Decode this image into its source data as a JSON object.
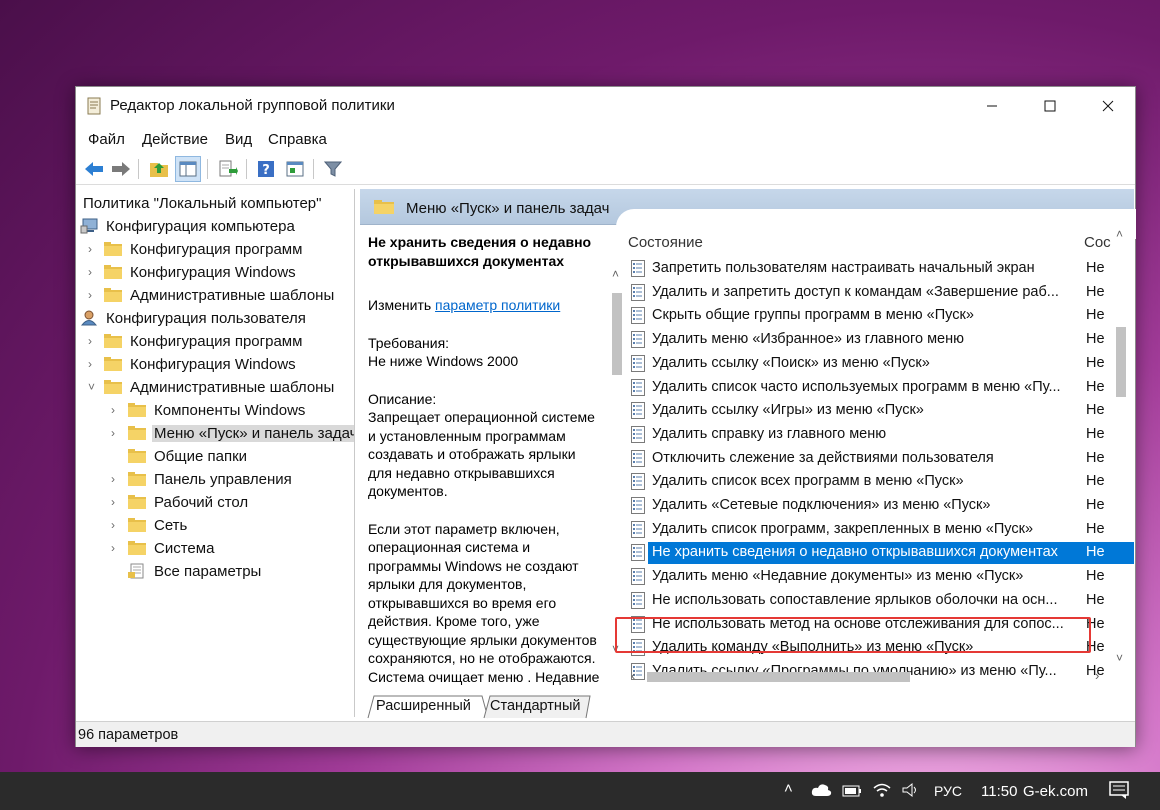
{
  "window": {
    "title": "Редактор локальной групповой политики",
    "menu": [
      "Файл",
      "Действие",
      "Вид",
      "Справка"
    ]
  },
  "tree": {
    "root": "Политика \"Локальный компьютер\"",
    "computer_config": "Конфигурация компьютера",
    "computer_children": [
      "Конфигурация программ",
      "Конфигурация Windows",
      "Административные шаблоны"
    ],
    "user_config": "Конфигурация пользователя",
    "user_children": [
      "Конфигурация программ",
      "Конфигурация Windows",
      "Административные шаблоны"
    ],
    "admin_children": [
      "Компоненты Windows",
      "Меню «Пуск» и панель задач",
      "Общие папки",
      "Панель управления",
      "Рабочий стол",
      "Сеть",
      "Система",
      "Все параметры"
    ]
  },
  "header": {
    "title": "Меню «Пуск» и панель задач"
  },
  "description": {
    "policy_title": "Не хранить сведения о недавно открывавшихся документах",
    "edit_prefix": "Изменить ",
    "edit_link": "параметр политики",
    "requirements_label": "Требования:",
    "requirements_value": "Не ниже Windows 2000",
    "description_label": "Описание:",
    "description_p1": "Запрещает операционной системе и установленным программам создавать и отображать ярлыки для недавно открывавшихся документов.",
    "description_p2": "Если этот параметр включен, операционная система и программы Windows не создают ярлыки для документов, открывавшихся во время его действия. Кроме того, уже существующие ярлыки документов сохраняются, но не отображаются. Система очищает меню . Недавние"
  },
  "list": {
    "col_state": "Состояние",
    "col_state2": "Сос",
    "rows": [
      {
        "name": "Запретить пользователям настраивать начальный экран",
        "state": "Не"
      },
      {
        "name": "Удалить и запретить доступ к командам «Завершение раб...",
        "state": "Не"
      },
      {
        "name": "Скрыть общие группы программ в меню «Пуск»",
        "state": "Не"
      },
      {
        "name": "Удалить меню «Избранное» из главного меню",
        "state": "Не"
      },
      {
        "name": "Удалить ссылку «Поиск» из меню «Пуск»",
        "state": "Не"
      },
      {
        "name": "Удалить список часто используемых программ в меню «Пу...",
        "state": "Не"
      },
      {
        "name": "Удалить ссылку «Игры» из меню «Пуск»",
        "state": "Не"
      },
      {
        "name": "Удалить справку из главного меню",
        "state": "Не"
      },
      {
        "name": "Отключить слежение за действиями пользователя",
        "state": "Не"
      },
      {
        "name": "Удалить список всех программ в меню «Пуск»",
        "state": "Не"
      },
      {
        "name": "Удалить «Сетевые подключения» из меню «Пуск»",
        "state": "Не"
      },
      {
        "name": "Удалить список программ, закрепленных в меню «Пуск»",
        "state": "Не"
      },
      {
        "name": "Не хранить сведения о недавно открывавшихся документах",
        "state": "Не"
      },
      {
        "name": "Удалить меню «Недавние документы» из меню «Пуск»",
        "state": "Не"
      },
      {
        "name": "Не использовать сопоставление ярлыков оболочки на осн...",
        "state": "Не"
      },
      {
        "name": "Не использовать метод на основе отслеживания для сопос...",
        "state": "Не"
      },
      {
        "name": "Удалить команду «Выполнить» из меню «Пуск»",
        "state": "Не"
      },
      {
        "name": "Удалить ссылку «Программы по умолчанию» из меню «Пу...",
        "state": "Не"
      }
    ]
  },
  "tabs": [
    "Расширенный",
    "Стандартный"
  ],
  "status": "96 параметров",
  "taskbar": {
    "lang": "РУС",
    "time": "11:50",
    "site": "G-ek.com"
  }
}
